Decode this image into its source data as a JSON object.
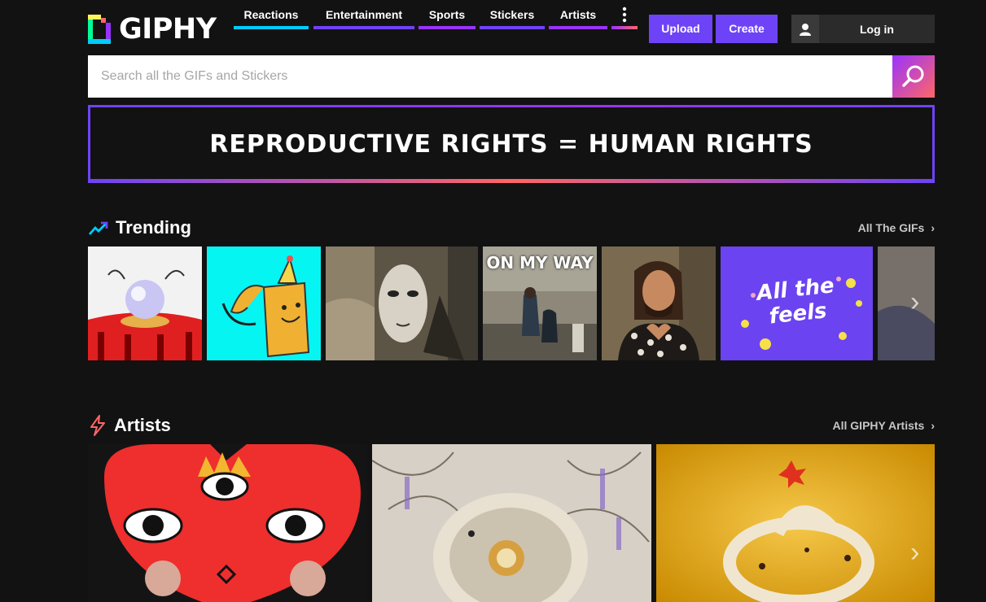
{
  "brand": {
    "name": "GIPHY"
  },
  "nav": {
    "items": [
      {
        "label": "Reactions",
        "color": "#00ccff"
      },
      {
        "label": "Entertainment",
        "color": "#6e43f7"
      },
      {
        "label": "Sports",
        "color": "#9933ff"
      },
      {
        "label": "Stickers",
        "color": "#6e43f7"
      },
      {
        "label": "Artists",
        "color": "#9933ff"
      }
    ],
    "more_icon": "vertical-ellipsis-icon",
    "upload_label": "Upload",
    "create_label": "Create",
    "login_label": "Log in"
  },
  "search": {
    "placeholder": "Search all the GIFs and Stickers",
    "value": ""
  },
  "banner": {
    "text": "REPRODUCTIVE RIGHTS = HUMAN RIGHTS"
  },
  "trending": {
    "title": "Trending",
    "link": "All The GIFs",
    "tiles": [
      {
        "kind": "crystal-ball"
      },
      {
        "kind": "party-cat"
      },
      {
        "kind": "masked-man"
      },
      {
        "kind": "on-my-way",
        "caption": "ON MY WAY"
      },
      {
        "kind": "man-heart"
      },
      {
        "kind": "all-the-feels",
        "caption_line1": "All the",
        "caption_line2": "feels"
      },
      {
        "kind": "partial"
      }
    ]
  },
  "artists": {
    "title": "Artists",
    "link": "All GIPHY Artists",
    "tiles": [
      {
        "kind": "heart-face"
      },
      {
        "kind": "sepia-portrait"
      },
      {
        "kind": "yellow-ring"
      }
    ]
  },
  "colors": {
    "accent": "#6e43f7",
    "background": "#121212"
  }
}
